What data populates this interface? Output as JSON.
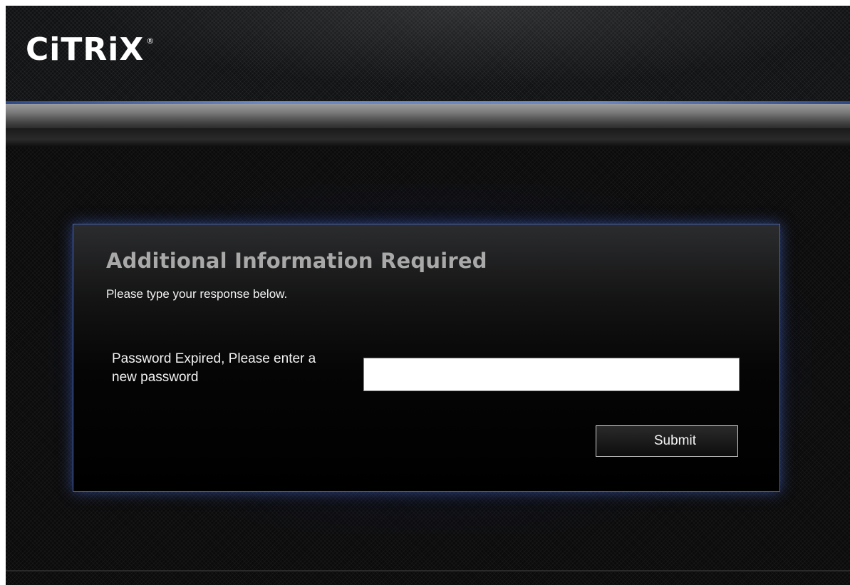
{
  "header": {
    "logo_text": "CiTRiX",
    "logo_registered": "®"
  },
  "dialog": {
    "title": "Additional Information Required",
    "subtitle": "Please type your response below.",
    "field_label": "Password Expired, Please enter a new password",
    "password_value": "",
    "submit_label": "Submit"
  },
  "colors": {
    "accent_blue": "#4865b8",
    "title_gray": "#a9a9a9",
    "background": "#0b0b0c"
  }
}
